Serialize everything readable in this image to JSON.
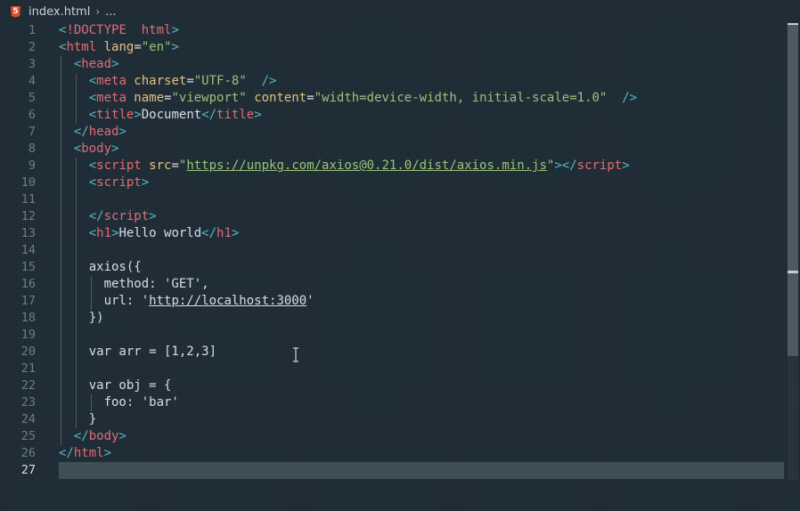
{
  "breadcrumb": {
    "icon": "html5-icon",
    "icon_glyph": "5",
    "file": "index.html",
    "separator": "›",
    "more": "..."
  },
  "editor": {
    "current_line": 27,
    "lines": [
      {
        "n": "1",
        "tokens": [
          [
            "br",
            "<"
          ],
          [
            "tag",
            "!DOCTYPE"
          ],
          [
            "",
            "  "
          ],
          [
            "tag",
            "html"
          ],
          [
            "br",
            ">"
          ]
        ]
      },
      {
        "n": "2",
        "tokens": [
          [
            "br",
            "<"
          ],
          [
            "tag",
            "html"
          ],
          [
            "attr",
            " lang"
          ],
          [
            "",
            "="
          ],
          [
            "str",
            "\"en\""
          ],
          [
            "br",
            ">"
          ]
        ]
      },
      {
        "n": "3",
        "tokens": [
          [
            "",
            "  "
          ],
          [
            "br",
            "<"
          ],
          [
            "tag",
            "head"
          ],
          [
            "br",
            ">"
          ]
        ]
      },
      {
        "n": "4",
        "tokens": [
          [
            "",
            "    "
          ],
          [
            "br",
            "<"
          ],
          [
            "tag",
            "meta"
          ],
          [
            "attr",
            " charset"
          ],
          [
            "",
            "="
          ],
          [
            "str",
            "\"UTF-8\""
          ],
          [
            "",
            ""
          ],
          [
            "br",
            "  />"
          ]
        ]
      },
      {
        "n": "5",
        "tokens": [
          [
            "",
            "    "
          ],
          [
            "br",
            "<"
          ],
          [
            "tag",
            "meta"
          ],
          [
            "attr",
            " name"
          ],
          [
            "",
            "="
          ],
          [
            "str",
            "\"viewport\""
          ],
          [
            "attr",
            " content"
          ],
          [
            "",
            "="
          ],
          [
            "str",
            "\"width=device-width, initial-scale=1.0\""
          ],
          [
            "br",
            "  />"
          ]
        ]
      },
      {
        "n": "6",
        "tokens": [
          [
            "",
            "    "
          ],
          [
            "br",
            "<"
          ],
          [
            "tag",
            "title"
          ],
          [
            "br",
            ">"
          ],
          [
            "",
            "Document"
          ],
          [
            "br",
            "</"
          ],
          [
            "tag",
            "title"
          ],
          [
            "br",
            ">"
          ]
        ]
      },
      {
        "n": "7",
        "tokens": [
          [
            "",
            "  "
          ],
          [
            "br",
            "</"
          ],
          [
            "tag",
            "head"
          ],
          [
            "br",
            ">"
          ]
        ]
      },
      {
        "n": "8",
        "tokens": [
          [
            "",
            "  "
          ],
          [
            "br",
            "<"
          ],
          [
            "tag",
            "body"
          ],
          [
            "br",
            ">"
          ]
        ]
      },
      {
        "n": "9",
        "tokens": [
          [
            "",
            "    "
          ],
          [
            "br",
            "<"
          ],
          [
            "tag",
            "script"
          ],
          [
            "attr",
            " src"
          ],
          [
            "",
            "="
          ],
          [
            "str",
            "\""
          ],
          [
            "url",
            "https://unpkg.com/axios@0.21.0/dist/axios.min.js"
          ],
          [
            "str",
            "\""
          ],
          [
            "br",
            "></"
          ],
          [
            "tag",
            "script"
          ],
          [
            "br",
            ">"
          ]
        ]
      },
      {
        "n": "10",
        "tokens": [
          [
            "",
            "    "
          ],
          [
            "br",
            "<"
          ],
          [
            "tag",
            "script"
          ],
          [
            "br",
            ">"
          ]
        ]
      },
      {
        "n": "11",
        "tokens": []
      },
      {
        "n": "12",
        "tokens": [
          [
            "",
            "    "
          ],
          [
            "br",
            "</"
          ],
          [
            "tag",
            "script"
          ],
          [
            "br",
            ">"
          ]
        ]
      },
      {
        "n": "13",
        "tokens": [
          [
            "",
            "    "
          ],
          [
            "br",
            "<"
          ],
          [
            "tag",
            "h1"
          ],
          [
            "br",
            ">"
          ],
          [
            "",
            "Hello world"
          ],
          [
            "br",
            "</"
          ],
          [
            "tag",
            "h1"
          ],
          [
            "br",
            ">"
          ]
        ]
      },
      {
        "n": "14",
        "tokens": []
      },
      {
        "n": "15",
        "tokens": [
          [
            "",
            "    axios({"
          ]
        ]
      },
      {
        "n": "16",
        "tokens": [
          [
            "",
            "      method: 'GET',"
          ]
        ]
      },
      {
        "n": "17",
        "tokens": [
          [
            "",
            "      url: '"
          ],
          [
            "plainurl",
            "http://localhost:3000"
          ],
          [
            "",
            "'"
          ]
        ]
      },
      {
        "n": "18",
        "tokens": [
          [
            "",
            "    })"
          ]
        ]
      },
      {
        "n": "19",
        "tokens": []
      },
      {
        "n": "20",
        "tokens": [
          [
            "",
            "    var arr = [1,2,3]"
          ]
        ]
      },
      {
        "n": "21",
        "tokens": []
      },
      {
        "n": "22",
        "tokens": [
          [
            "",
            "    var obj = {"
          ]
        ]
      },
      {
        "n": "23",
        "tokens": [
          [
            "",
            "      foo: 'bar'"
          ]
        ]
      },
      {
        "n": "24",
        "tokens": [
          [
            "",
            "    }"
          ]
        ]
      },
      {
        "n": "25",
        "tokens": [
          [
            "",
            "  "
          ],
          [
            "br",
            "</"
          ],
          [
            "tag",
            "body"
          ],
          [
            "br",
            ">"
          ]
        ]
      },
      {
        "n": "26",
        "tokens": [
          [
            "br",
            "</"
          ],
          [
            "tag",
            "html"
          ],
          [
            "br",
            ">"
          ]
        ]
      },
      {
        "n": "27",
        "tokens": []
      }
    ]
  },
  "colors": {
    "background": "#1d2b35",
    "tag": "#e06c75",
    "bracket": "#56b6c2",
    "attribute": "#e5c07b",
    "string": "#98c379"
  }
}
